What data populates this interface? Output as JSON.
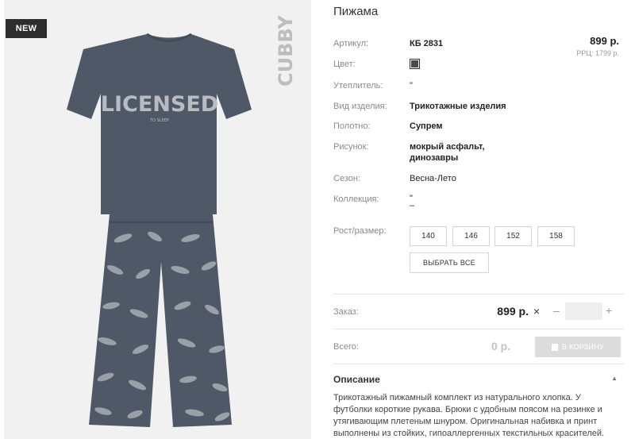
{
  "product": {
    "badge": "NEW",
    "brand": "CUBBY",
    "print_text": "LICENSED",
    "print_subtext": "TO SLEEP",
    "title": "Пижама",
    "price": "899 р.",
    "rrp": "РРЦ: 1799 р."
  },
  "attributes": [
    {
      "label": "Артикул:",
      "value": "КБ 2831"
    },
    {
      "label": "Цвет:",
      "value": ""
    },
    {
      "label": "Утеплитель:",
      "value": "\""
    },
    {
      "label": "Вид изделия:",
      "value": "Трикотажные изделия"
    },
    {
      "label": "Полотно:",
      "value": "Супрем"
    },
    {
      "label": "Рисунок:",
      "value": "мокрый асфальт,",
      "value2": "динозавры"
    },
    {
      "label": "Сезон:",
      "value": "Весна-Лето"
    },
    {
      "label": "Коллекция:",
      "value": "\"",
      "value2": "–"
    }
  ],
  "colors": {
    "swatch": "#4a4a4a",
    "garment": "#4f5866",
    "print": "#b8bcc2"
  },
  "sizes": {
    "label": "Рост/размер:",
    "options": [
      "140",
      "146",
      "152",
      "158"
    ],
    "select_all": "ВЫБРАТЬ ВСЕ"
  },
  "order": {
    "label": "Заказ:",
    "price": "899 р.",
    "remove": "×",
    "minus": "–",
    "plus": "+",
    "qty": ""
  },
  "total": {
    "label": "Всего:",
    "value": "0 р.",
    "cart_button": "В КОРЗИНУ"
  },
  "description": {
    "heading": "Описание",
    "text": "Трикотажный пижамный комплект из натурального хлопка. У футболки короткие рукава. Брюки с удобным поясом на резинке и утягивающим плетеным шнуром. Оригинальная набивка и принт выполнены из стойких, гипоаллергенных текстильных красителей."
  }
}
